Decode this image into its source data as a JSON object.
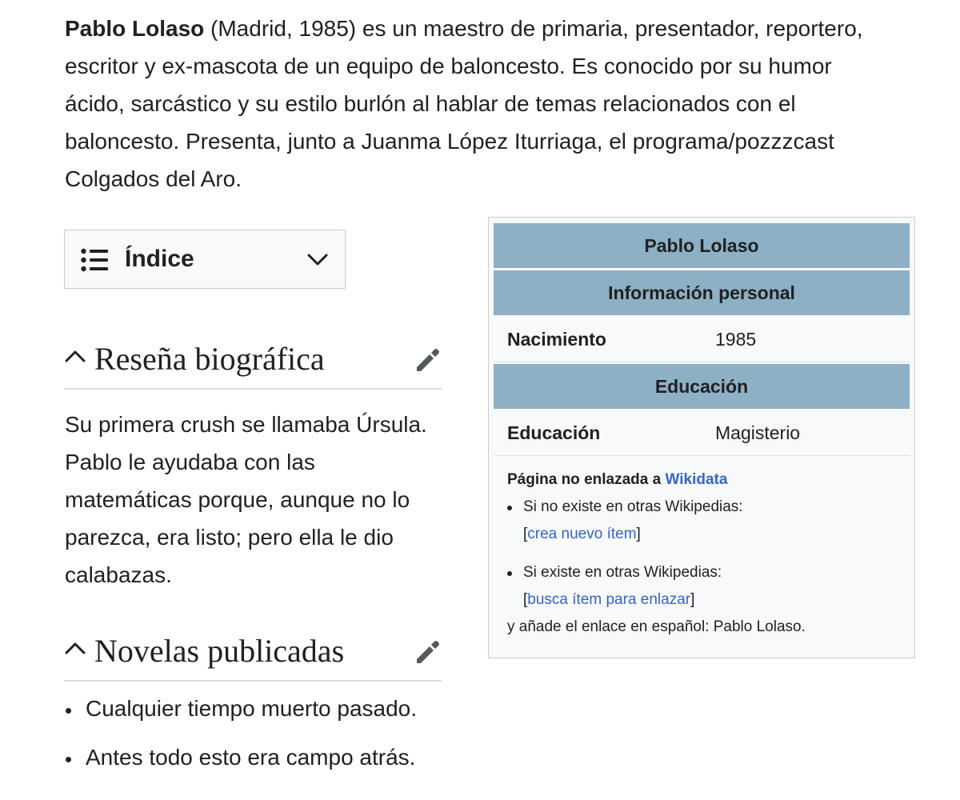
{
  "intro": {
    "name": "Pablo Lolaso",
    "text": " (Madrid, 1985) es un maestro de primaria, presentador, reportero, escritor y ex-mascota de un equipo de baloncesto. Es conocido por su humor ácido, sarcástico y su estilo burlón al hablar de temas relacionados con el baloncesto. Presenta, junto a Juanma López Iturriaga, el programa/pozzzcast Colgados del Aro."
  },
  "toc": {
    "label": "Índice",
    "icon": "list-icon",
    "toggle_icon": "chevron-down-icon"
  },
  "sections": [
    {
      "title": "Reseña biográfica",
      "body": "Su primera crush se llamaba Úrsula. Pablo le ayudaba con las matemáticas porque, aunque no lo parezca, era listo; pero ella le dio calabazas."
    },
    {
      "title": "Novelas publicadas",
      "items": [
        "Cualquier tiempo muerto pasado.",
        "Antes todo esto era campo atrás."
      ]
    }
  ],
  "infobox": {
    "title": "Pablo Lolaso",
    "header_personal": "Información personal",
    "birth_label": "Nacimiento",
    "birth_value": "1985",
    "header_education": "Educación",
    "education_label": "Educación",
    "education_value": "Magisterio",
    "footer": {
      "title_prefix": "Página no enlazada a ",
      "title_link": "Wikidata",
      "item1_text": "Si no existe en otras Wikipedias:",
      "item1_link": "crea nuevo ítem",
      "item2_text": "Si existe en otras Wikipedias:",
      "item2_link": "busca ítem para enlazar",
      "tail": "y añade el enlace en español: Pablo Lolaso.",
      "bracket_open": "[",
      "bracket_close": "]"
    }
  },
  "colors": {
    "link": "#3366cc",
    "infobox_header": "#8db0c4",
    "text": "#202122"
  }
}
